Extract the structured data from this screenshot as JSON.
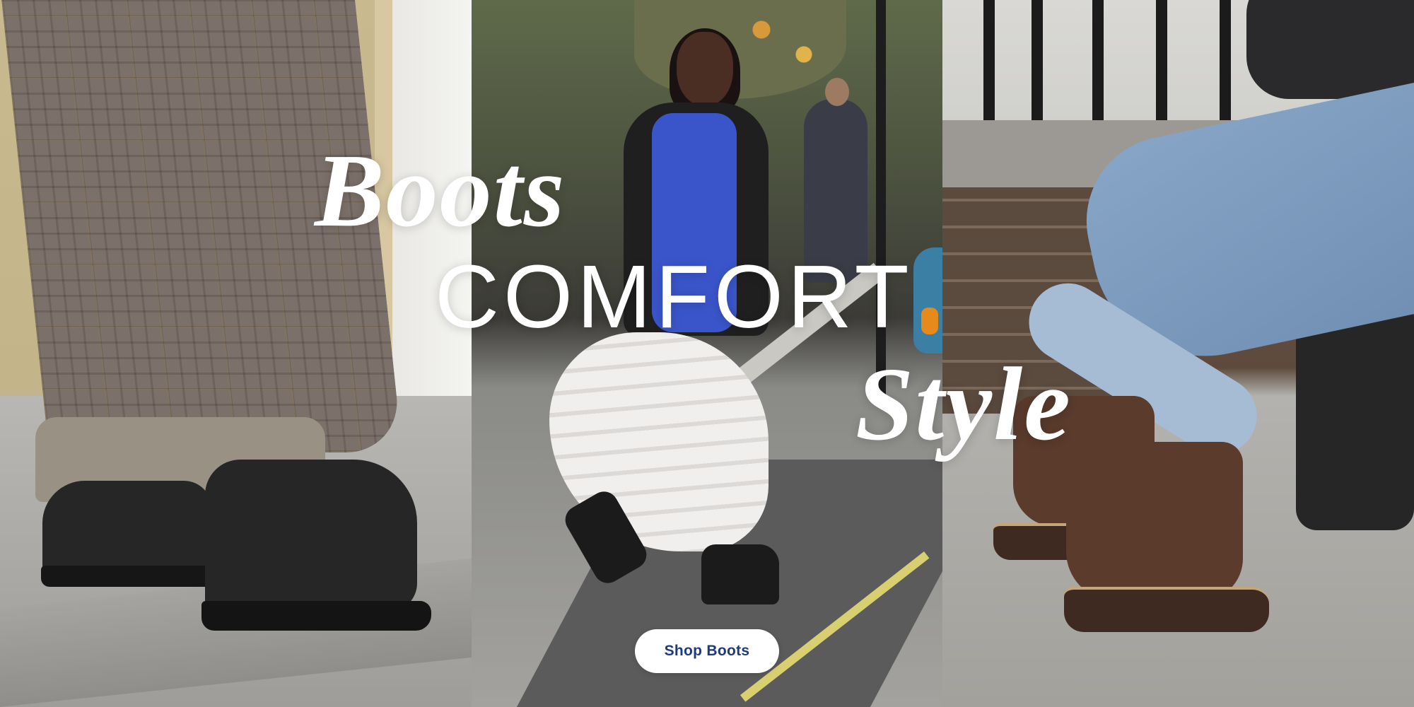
{
  "hero": {
    "headline_line1": "Boots",
    "headline_line2": "COMFORT",
    "headline_line3": "Style",
    "cta_label": "Shop Boots"
  },
  "colors": {
    "headline_text": "#ffffff",
    "cta_background": "#ffffff",
    "cta_text": "#1f3b7a"
  },
  "panels": [
    {
      "name": "black-chelsea-boots-plaid-coat"
    },
    {
      "name": "woman-walking-white-skirt-black-boots"
    },
    {
      "name": "brown-chelsea-boots-cuffed-jeans"
    }
  ]
}
